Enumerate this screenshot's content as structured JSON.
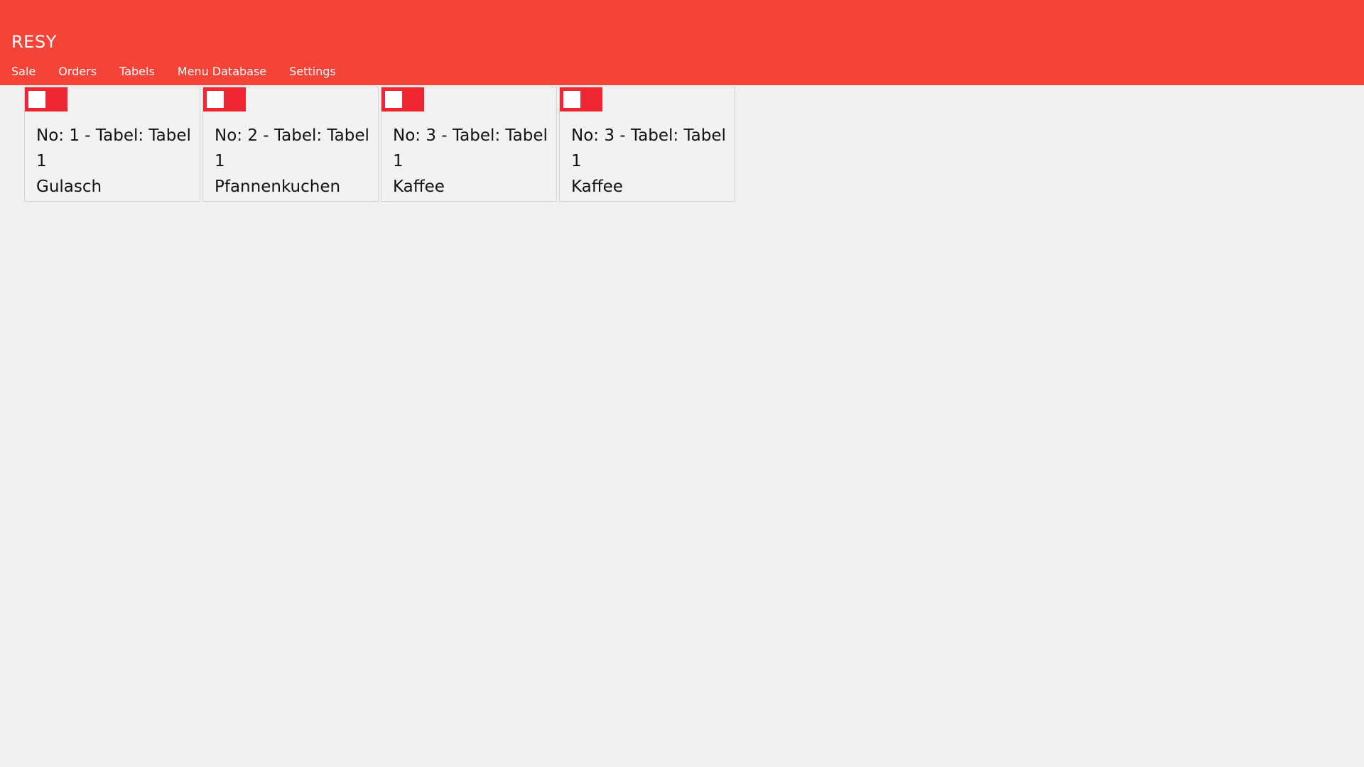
{
  "app": {
    "title": "RESY"
  },
  "nav": {
    "items": [
      {
        "label": "Sale"
      },
      {
        "label": "Orders"
      },
      {
        "label": "Tabels"
      },
      {
        "label": "Menu Database"
      },
      {
        "label": "Settings"
      }
    ]
  },
  "colors": {
    "appbar": "#f44337",
    "toggle": "#ef2732",
    "background": "#f1f1f1"
  },
  "orders": [
    {
      "line1": "No: 1 - Tabel: Tabel",
      "line2": "1",
      "item": "Gulasch",
      "toggle_on": false
    },
    {
      "line1": "No: 2 - Tabel: Tabel",
      "line2": "1",
      "item": "Pfannenkuchen",
      "toggle_on": false
    },
    {
      "line1": "No: 3 - Tabel: Tabel",
      "line2": "1",
      "item": "Kaffee",
      "toggle_on": false
    },
    {
      "line1": "No: 3 - Tabel: Tabel",
      "line2": "1",
      "item": "Kaffee",
      "toggle_on": false
    }
  ]
}
